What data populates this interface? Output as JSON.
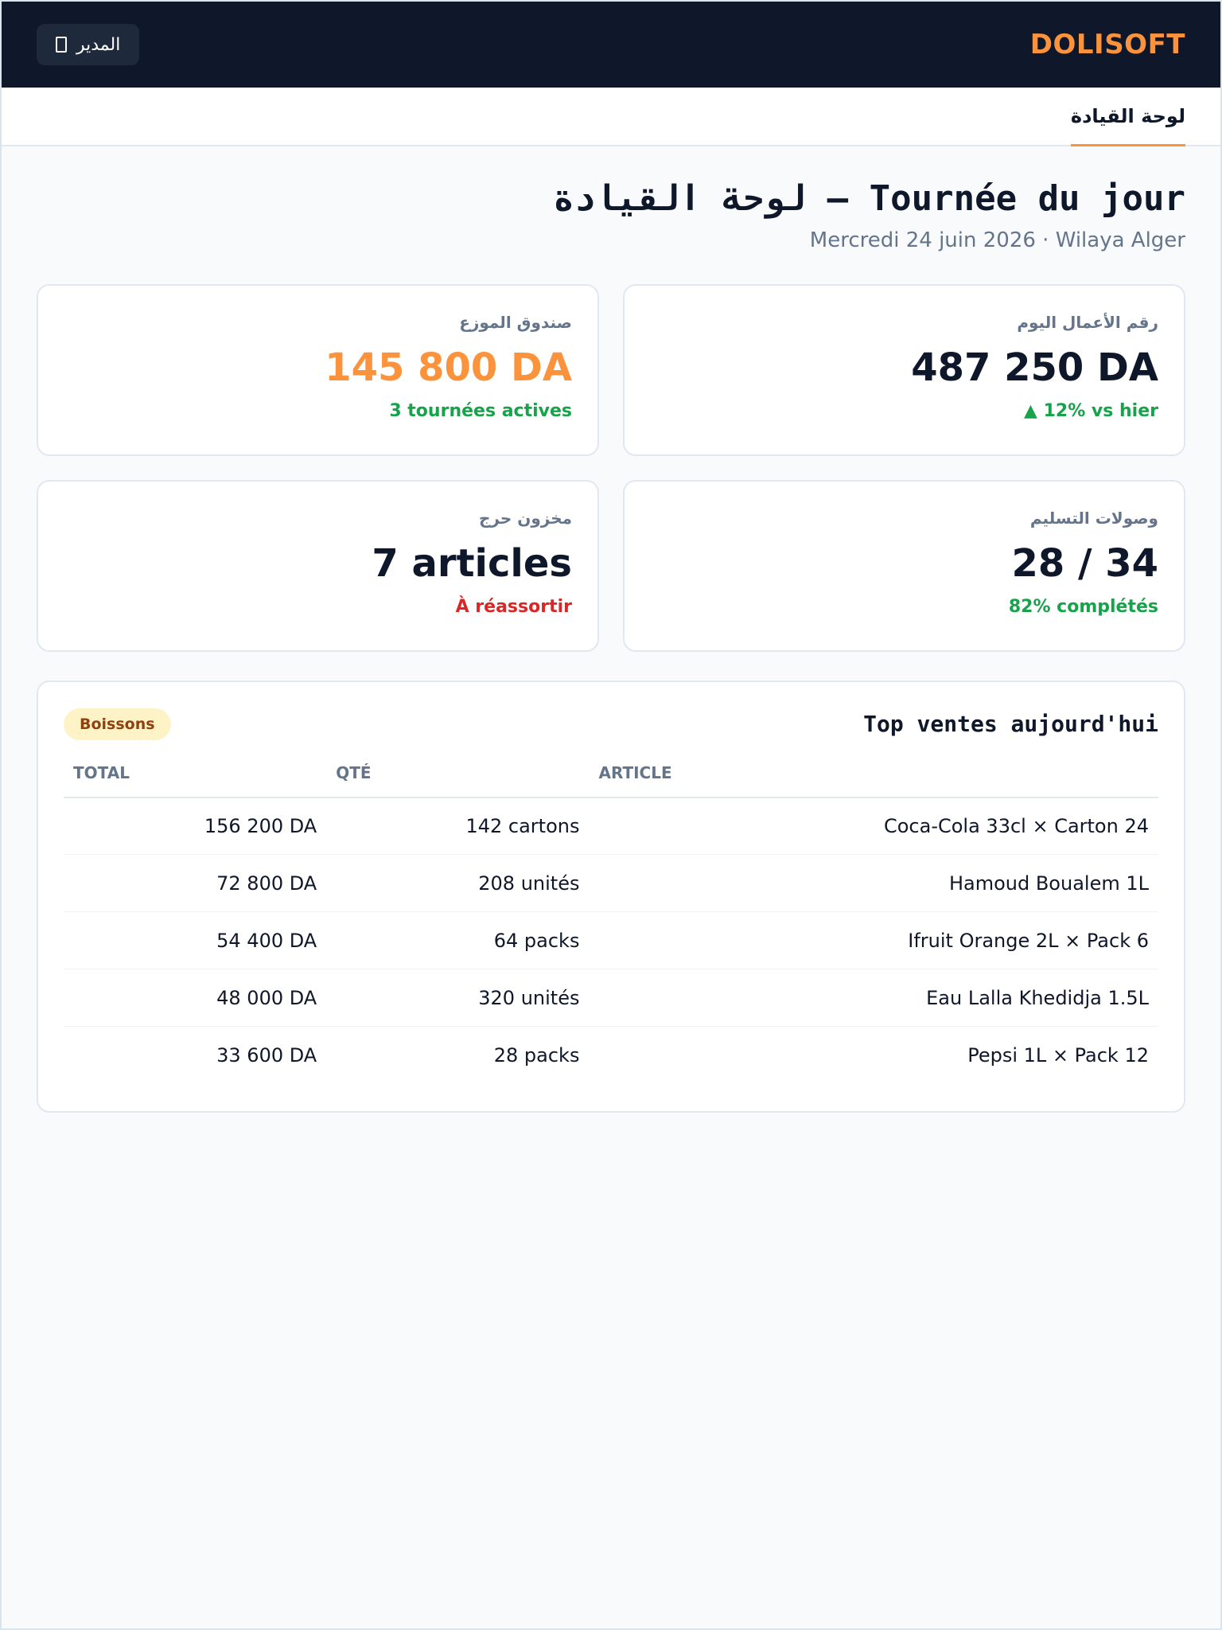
{
  "topbar": {
    "brand": "DOLISOFT",
    "user_label": "المدير",
    "user_icon": "user-icon"
  },
  "nav": {
    "active_tab": "لوحة القيادة"
  },
  "header": {
    "title": "لوحة القيادة — Tournée du jour",
    "subtitle": "Mercredi 24 juin 2026 · Wilaya Alger"
  },
  "cards": [
    {
      "label": "رقم الأعمال اليوم",
      "value": "487 250 DA",
      "note": "▲ 12% vs hier",
      "value_color": "#0f172a",
      "note_color": "#16a34a"
    },
    {
      "label": "صندوق الموزع",
      "value": "145 800 DA",
      "note": "3 tournées actives",
      "value_color": "#fb923c",
      "note_color": "#16a34a"
    },
    {
      "label": "وصولات التسليم",
      "value": "28 / 34",
      "note": "82% complétés",
      "value_color": "#0f172a",
      "note_color": "#16a34a"
    },
    {
      "label": "مخزون حرج",
      "value": "7 articles",
      "note": "À réassortir",
      "value_color": "#0f172a",
      "note_color": "#dc2626"
    }
  ],
  "top_sales": {
    "title": "Top ventes aujourd'hui",
    "badge": "Boissons",
    "columns": {
      "total": "TOTAL",
      "qty": "QTÉ",
      "article": "ARTICLE"
    },
    "rows": [
      {
        "total": "156 200 DA",
        "qty": "142 cartons",
        "article": "Coca-Cola 33cl × Carton 24"
      },
      {
        "total": "72 800 DA",
        "qty": "208 unités",
        "article": "Hamoud Boualem 1L"
      },
      {
        "total": "54 400 DA",
        "qty": "64 packs",
        "article": "Ifruit Orange 2L × Pack 6"
      },
      {
        "total": "48 000 DA",
        "qty": "320 unités",
        "article": "Eau Lalla Khedidja 1.5L"
      },
      {
        "total": "33 600 DA",
        "qty": "28 packs",
        "article": "Pepsi 1L × Pack 12"
      }
    ]
  },
  "colors": {
    "accent": "#fb923c",
    "topbar_bg": "#0f172a",
    "positive": "#16a34a",
    "negative": "#dc2626"
  }
}
